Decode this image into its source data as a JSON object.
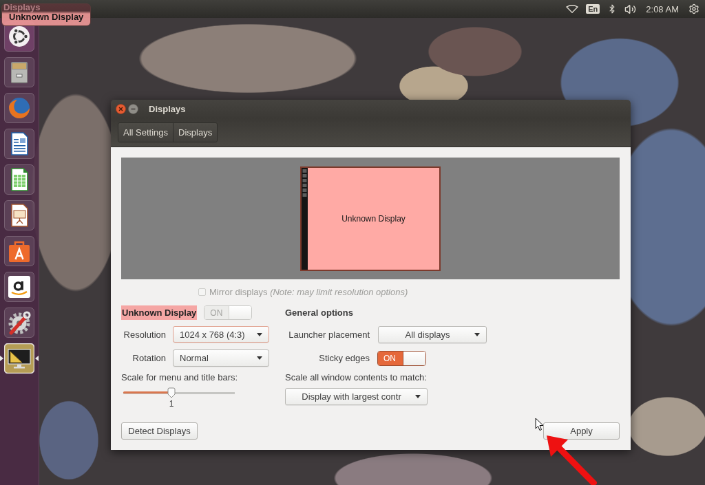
{
  "top_panel": {
    "app_title": "Displays",
    "keyboard_layout": "En",
    "clock": "2:08 AM"
  },
  "tooltip": {
    "text": "Unknown Display"
  },
  "launcher": [
    {
      "kind": "dash",
      "active": false
    },
    {
      "kind": "files",
      "active": false
    },
    {
      "kind": "browser",
      "active": false
    },
    {
      "kind": "writer",
      "active": false
    },
    {
      "kind": "calc",
      "active": false
    },
    {
      "kind": "impress",
      "active": false
    },
    {
      "kind": "store",
      "active": false
    },
    {
      "kind": "amazon",
      "active": false
    },
    {
      "kind": "settings",
      "active": false
    },
    {
      "kind": "displays",
      "active": true
    }
  ],
  "window": {
    "title": "Displays",
    "breadcrumbs": [
      "All Settings",
      "Displays"
    ]
  },
  "preview": {
    "monitors": [
      {
        "label": "Unknown Display"
      }
    ]
  },
  "mirror": {
    "text": "Mirror displays *(Note: may limit resolution options)*",
    "checked": false,
    "disabled": true
  },
  "display": {
    "name": "Unknown Display",
    "switch": {
      "label": "ON",
      "on": true,
      "disabled": true
    },
    "resolution": {
      "label": "Resolution",
      "value": "1024 x 768 (4:3)",
      "focused": true
    },
    "rotation": {
      "label": "Rotation",
      "value": "Normal",
      "focused": false
    },
    "scale": {
      "label": "Scale for menu and title bars:",
      "level": 0.43,
      "reading": "1"
    }
  },
  "general": {
    "title": "General options",
    "launcher_placement": {
      "label": "Launcher placement",
      "value": "All displays"
    },
    "sticky_edges": {
      "label": "Sticky edges",
      "switch": {
        "label": "ON",
        "on": true,
        "disabled": false
      }
    },
    "scale_all": {
      "label": "Scale all window contents to match:",
      "value": "Display with largest contr"
    }
  },
  "buttons": {
    "detect": "Detect Displays",
    "apply": "Apply"
  }
}
